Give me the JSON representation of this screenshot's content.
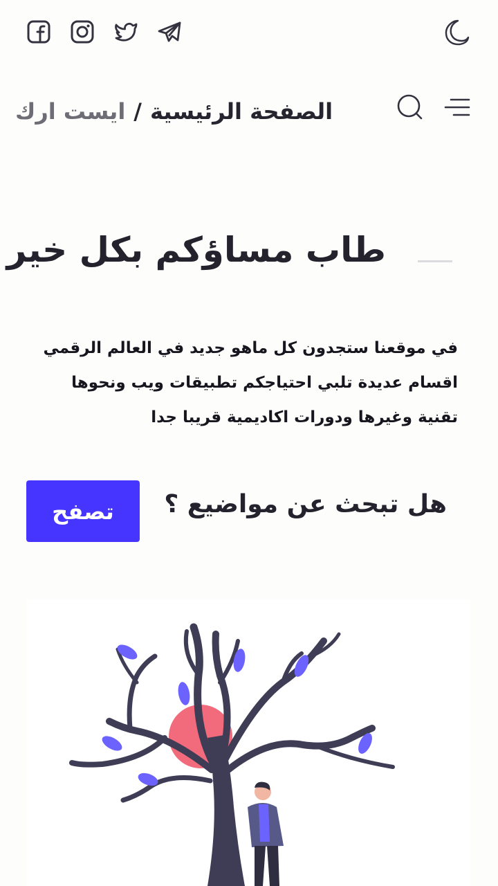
{
  "social": {
    "icons": [
      "facebook-icon",
      "instagram-icon",
      "twitter-icon",
      "telegram-icon"
    ]
  },
  "theme_toggle_icon": "moon-icon",
  "header": {
    "breadcrumb_home": "الصفحة الرئيسية",
    "breadcrumb_separator": "/",
    "breadcrumb_site": "ايست ارك",
    "search_icon": "search-icon",
    "menu_icon": "menu-icon"
  },
  "hero": {
    "title": "طاب مساؤكم بكل خير",
    "description_lines": [
      "في موقعنا ستجدون كل ماهو جديد في العالم الرقمي",
      "اقسام عديدة تلبي احتياجكم تطبيقات ويب ونحوها",
      "تقنية وغيرها ودورات اكاديمية قريبا جدا"
    ],
    "question": "هل تبحث عن مواضيع ؟",
    "button_label": "تصفح"
  },
  "colors": {
    "accent": "#4635ff",
    "text_dark": "#24232d",
    "text_muted": "#6e6d76",
    "leaf": "#6c63ff",
    "sun": "#f16b7c",
    "trunk": "#3f3d56"
  }
}
